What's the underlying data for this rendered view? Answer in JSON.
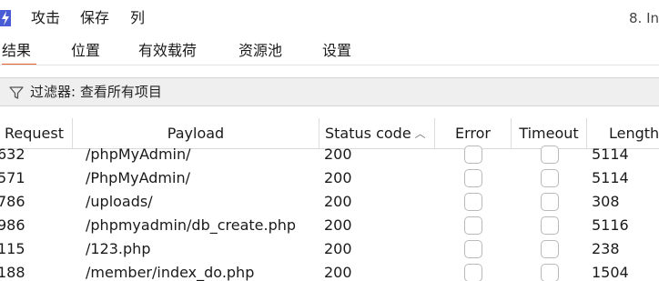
{
  "menubar": {
    "items": [
      "攻击",
      "保存",
      "列"
    ],
    "window_title": "8. In"
  },
  "tabs": [
    {
      "label": "结果",
      "active": true
    },
    {
      "label": "位置",
      "active": false
    },
    {
      "label": "有效载荷",
      "active": false
    },
    {
      "label": "资源池",
      "active": false
    },
    {
      "label": "设置",
      "active": false
    }
  ],
  "filter": {
    "text": "过滤器: 查看所有项目",
    "icon": "filter-icon"
  },
  "table": {
    "columns": [
      "Request",
      "Payload",
      "Status code",
      "Error",
      "Timeout",
      "Length"
    ],
    "sorted_column": "Status code",
    "sort_direction": "ascending",
    "rows": [
      {
        "request": "632",
        "payload": "/phpMyAdmin/",
        "status": "200",
        "error": false,
        "timeout": false,
        "length": "5114"
      },
      {
        "request": "571",
        "payload": "/PhpMyAdmin/",
        "status": "200",
        "error": false,
        "timeout": false,
        "length": "5114"
      },
      {
        "request": "786",
        "payload": "/uploads/",
        "status": "200",
        "error": false,
        "timeout": false,
        "length": "308"
      },
      {
        "request": "986",
        "payload": "/phpmyadmin/db_create.php",
        "status": "200",
        "error": false,
        "timeout": false,
        "length": "5116"
      },
      {
        "request": "115",
        "payload": "/123.php",
        "status": "200",
        "error": false,
        "timeout": false,
        "length": "238"
      },
      {
        "request": "188",
        "payload": "/member/index_do.php",
        "status": "200",
        "error": false,
        "timeout": false,
        "length": "1504"
      }
    ]
  },
  "colors": {
    "accent": "#e8632b",
    "app_icon": "#4a5bd6",
    "filter_bg": "#efefef"
  }
}
